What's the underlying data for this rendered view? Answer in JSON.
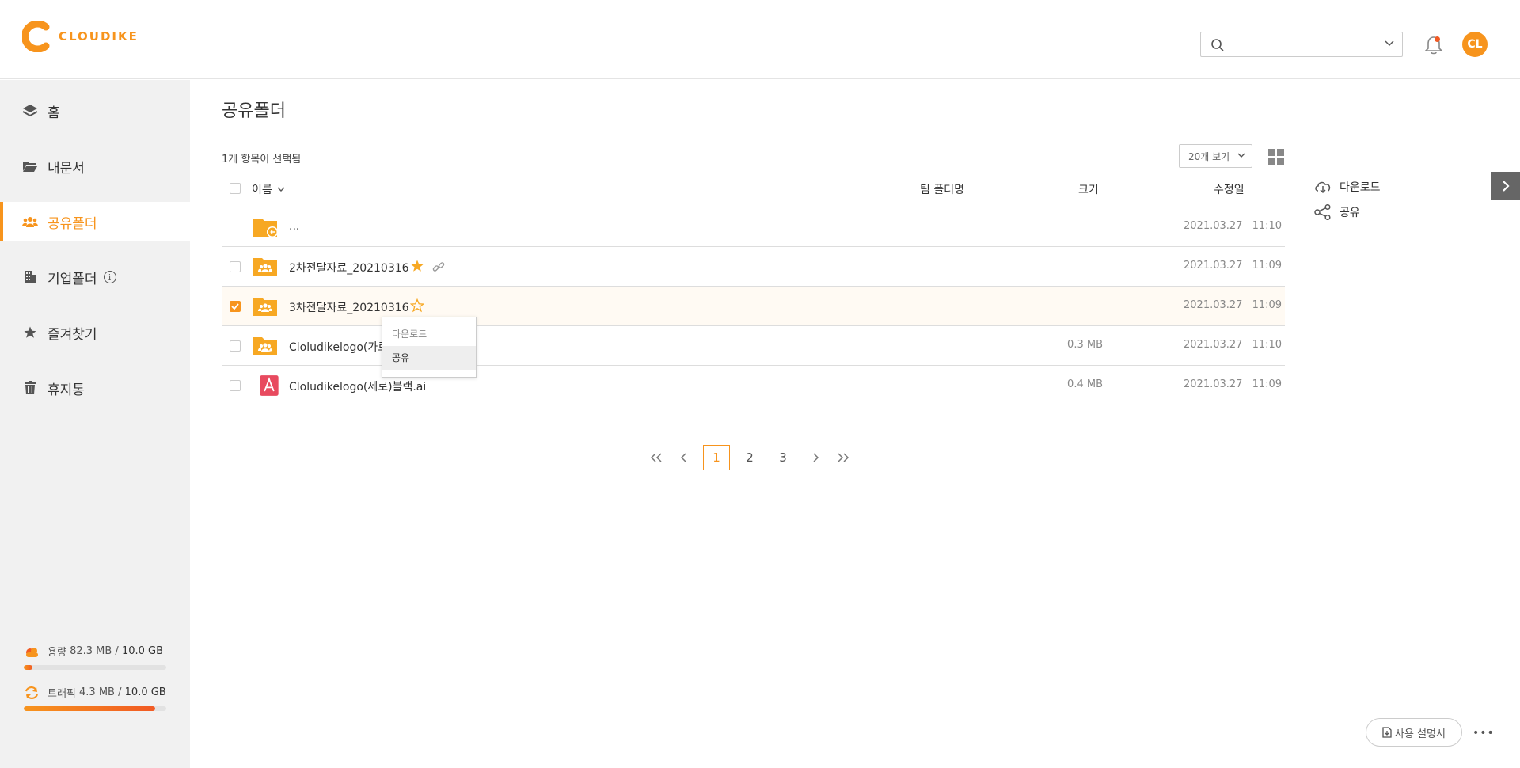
{
  "app": {
    "brand": "CLOUDIKE",
    "avatar_initials": "CL",
    "accent_color": "#f7941d"
  },
  "search": {
    "placeholder": ""
  },
  "sidebar": {
    "items": [
      {
        "label": "홈",
        "icon": "layers-icon"
      },
      {
        "label": "내문서",
        "icon": "folder-open-icon"
      },
      {
        "label": "공유폴더",
        "icon": "users-icon",
        "active": true
      },
      {
        "label": "기업폴더",
        "icon": "building-icon"
      },
      {
        "label": "즐겨찾기",
        "icon": "star-icon"
      },
      {
        "label": "휴지통",
        "icon": "trash-icon"
      }
    ],
    "storage": {
      "label": "용량",
      "used": "82.3 MB",
      "sep": "/",
      "total": "10.0 GB",
      "fraction": 0.008
    },
    "traffic": {
      "label": "트래픽",
      "used": "4.3 MB",
      "sep": "/",
      "total": "10.0 GB",
      "fraction": 0.92
    }
  },
  "main": {
    "title": "공유폴더",
    "selection_text": "1개 항목이 선택됨",
    "per_page": "20개 보기",
    "columns": {
      "name": "이름",
      "team_folder": "팀 폴더명",
      "size": "크기",
      "modified": "수정일"
    },
    "rows": [
      {
        "name": "...",
        "size": "",
        "date": "2021.03.27 11:10",
        "type": "parent-folder"
      },
      {
        "name": "2차전달자료_20210316",
        "size": "",
        "date": "2021.03.27 11:09",
        "type": "shared-folder",
        "favorite": true,
        "linked": true
      },
      {
        "name": "3차전달자료_20210316",
        "size": "",
        "date": "2021.03.27 11:09",
        "type": "shared-folder",
        "favorite": false,
        "selected": true
      },
      {
        "name": "Cloludikelogo(가로",
        "size": "0.3 MB",
        "date": "2021.03.27 11:10",
        "type": "shared-folder"
      },
      {
        "name": "Cloludikelogo(세로)블랙.ai",
        "size": "0.4 MB",
        "date": "2021.03.27 11:09",
        "type": "pdf-file"
      }
    ],
    "context_menu": {
      "download": "다운로드",
      "share": "공유"
    },
    "pagination": {
      "pages": [
        "1",
        "2",
        "3"
      ],
      "current": "1"
    }
  },
  "right_panel": {
    "download": "다운로드",
    "share": "공유"
  },
  "footer": {
    "manual": "사용 설명서",
    "more": "•••"
  }
}
